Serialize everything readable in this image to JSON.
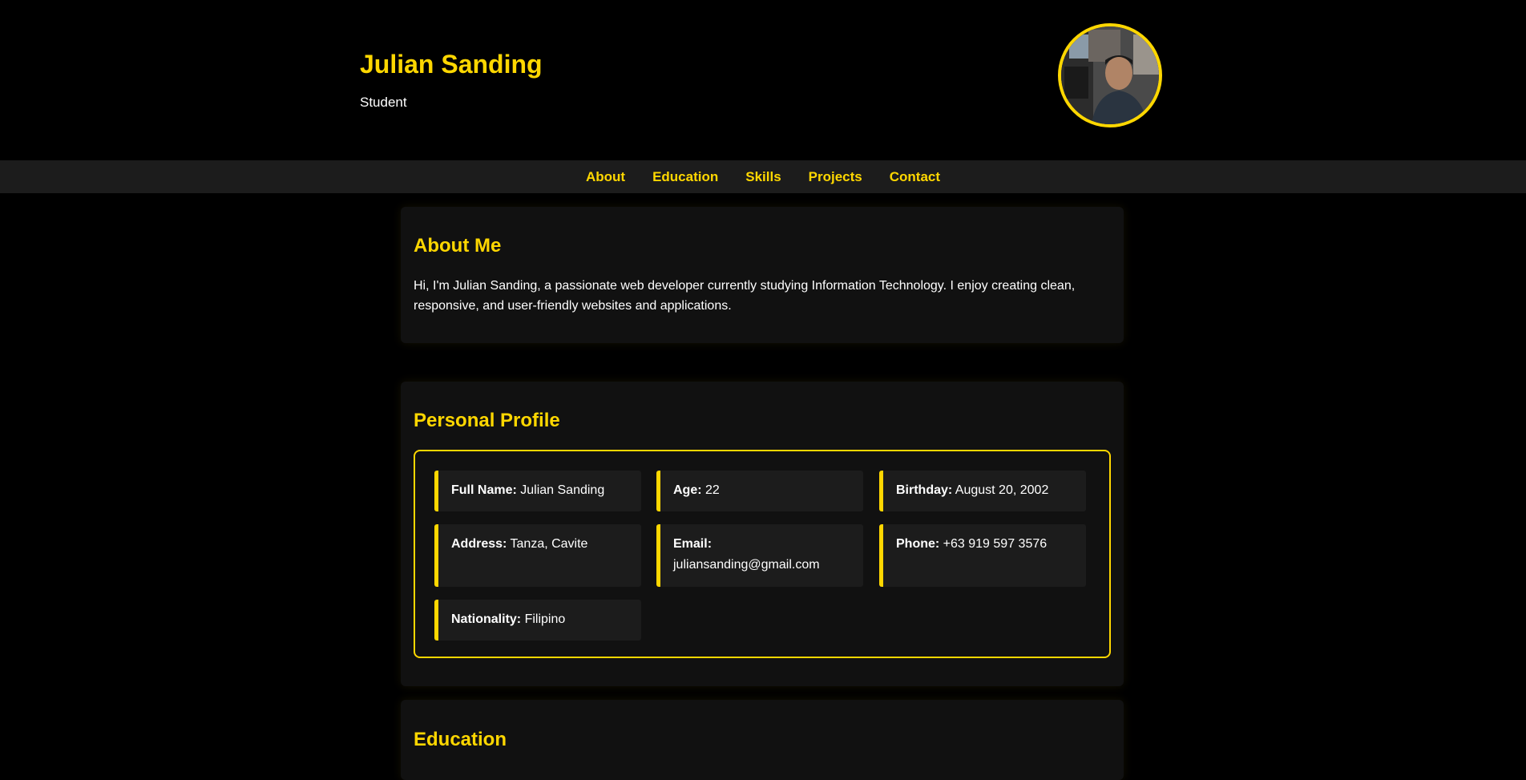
{
  "header": {
    "name": "Julian Sanding",
    "role": "Student"
  },
  "nav": {
    "items": [
      "About",
      "Education",
      "Skills",
      "Projects",
      "Contact"
    ]
  },
  "about": {
    "title": "About Me",
    "text": "Hi, I'm Julian Sanding, a passionate web developer currently studying Information Technology. I enjoy creating clean, responsive, and user-friendly websites and applications."
  },
  "profile": {
    "title": "Personal Profile",
    "fields": [
      {
        "label": "Full Name:",
        "value": "Julian Sanding"
      },
      {
        "label": "Age:",
        "value": "22"
      },
      {
        "label": "Birthday:",
        "value": "August 20, 2002"
      },
      {
        "label": "Address:",
        "value": "Tanza, Cavite"
      },
      {
        "label": "Email:",
        "value": "juliansanding@gmail.com"
      },
      {
        "label": "Phone:",
        "value": "+63 919 597 3576"
      },
      {
        "label": "Nationality:",
        "value": "Filipino"
      }
    ]
  },
  "education": {
    "title": "Education"
  },
  "colors": {
    "background": "#000000",
    "accent": "#FFD700",
    "card": "#111111",
    "nav": "#1c1c1c"
  }
}
